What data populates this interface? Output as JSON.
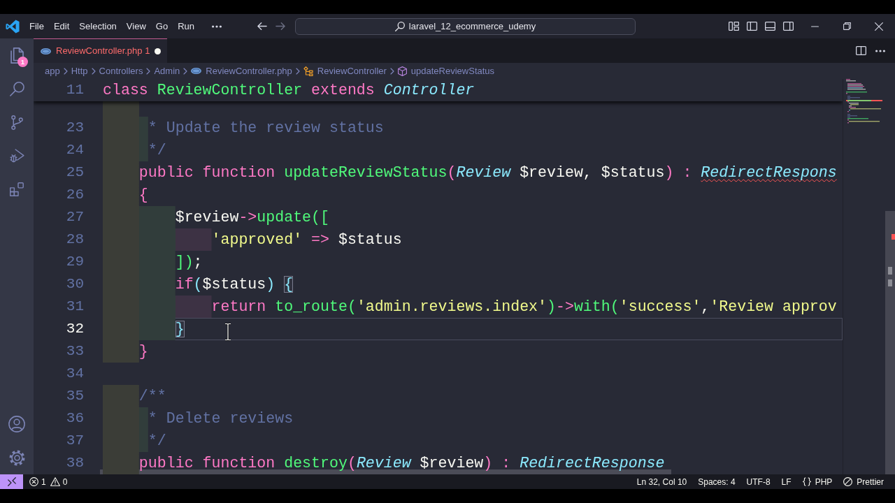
{
  "title_bar": {
    "menus": [
      "File",
      "Edit",
      "Selection",
      "View",
      "Go",
      "Run"
    ],
    "navigation": [
      {
        "kind": "back",
        "disabled": false
      },
      {
        "kind": "forward",
        "disabled": true
      }
    ],
    "search": "laravel_12_ecommerce_udemy"
  },
  "activity_bar": {
    "items": [
      {
        "kind": "explorer",
        "badge": "1",
        "selected": false
      },
      {
        "kind": "search",
        "selected": false
      },
      {
        "kind": "source-control",
        "selected": false
      },
      {
        "kind": "run-debug",
        "selected": false
      },
      {
        "kind": "extensions",
        "selected": false
      }
    ],
    "bottom_items": [
      {
        "kind": "accounts"
      },
      {
        "kind": "manage"
      }
    ]
  },
  "tabs": [
    {
      "label": "ReviewController.php",
      "problems": "1",
      "error": true,
      "dirty": true,
      "selected": true
    }
  ],
  "breadcrumb": [
    {
      "kind": "folder",
      "label": "app"
    },
    {
      "kind": "folder",
      "label": "Http"
    },
    {
      "kind": "folder",
      "label": "Controllers"
    },
    {
      "kind": "folder",
      "label": "Admin"
    },
    {
      "kind": "file",
      "label": "ReviewController.php"
    },
    {
      "kind": "class",
      "label": "ReviewController"
    },
    {
      "kind": "method",
      "label": "updateReviewStatus"
    }
  ],
  "editor": {
    "sticky_lines": [
      {
        "number": "11",
        "current": false,
        "tokens": [
          {
            "text": "class ",
            "kind": "keyword",
            "error": false,
            "matched": false
          },
          {
            "text": "ReviewController ",
            "kind": "entity",
            "error": false,
            "matched": false
          },
          {
            "text": "extends ",
            "kind": "keyword",
            "error": false,
            "matched": false
          },
          {
            "text": "Controller",
            "kind": "type",
            "error": false,
            "matched": false
          }
        ]
      }
    ],
    "lines": [
      {
        "number": "23",
        "current": false,
        "tokens": [
          {
            "text": "     * Update the review status",
            "kind": "comment",
            "error": false,
            "matched": false
          }
        ]
      },
      {
        "number": "24",
        "current": false,
        "tokens": [
          {
            "text": "     */",
            "kind": "comment",
            "error": false,
            "matched": false
          }
        ]
      },
      {
        "number": "25",
        "current": false,
        "tokens": [
          {
            "text": "    public function ",
            "kind": "keyword",
            "error": false,
            "matched": false
          },
          {
            "text": "updateReviewStatus",
            "kind": "entity",
            "error": false,
            "matched": false
          },
          {
            "text": "(",
            "kind": "bracket",
            "color": "#ff79c6",
            "error": false,
            "matched": false
          },
          {
            "text": "Review",
            "kind": "type",
            "error": false,
            "matched": false
          },
          {
            "text": " $review",
            "kind": "variable",
            "error": false,
            "matched": false
          },
          {
            "text": ", ",
            "kind": "plain",
            "error": false,
            "matched": false
          },
          {
            "text": "$status",
            "kind": "variable",
            "error": false,
            "matched": false
          },
          {
            "text": ")",
            "kind": "bracket",
            "color": "#ff79c6",
            "error": false,
            "matched": false
          },
          {
            "text": " : ",
            "kind": "operator",
            "error": false,
            "matched": false
          },
          {
            "text": "RedirectRespons",
            "kind": "type",
            "error": true,
            "matched": false
          }
        ]
      },
      {
        "number": "26",
        "current": false,
        "tokens": [
          {
            "text": "    {",
            "kind": "bracket",
            "color": "#ff79c6",
            "error": false,
            "matched": false
          }
        ]
      },
      {
        "number": "27",
        "current": false,
        "tokens": [
          {
            "text": "        $review",
            "kind": "variable",
            "error": false,
            "matched": false
          },
          {
            "text": "->",
            "kind": "operator",
            "error": false,
            "matched": false
          },
          {
            "text": "update",
            "kind": "entity",
            "error": false,
            "matched": false
          },
          {
            "text": "(",
            "kind": "bracket",
            "color": "#50fa7b",
            "error": false,
            "matched": false
          },
          {
            "text": "[",
            "kind": "bracket",
            "color": "#50fa7b",
            "error": false,
            "matched": false
          }
        ]
      },
      {
        "number": "28",
        "current": false,
        "tokens": [
          {
            "text": "            'approved'",
            "kind": "string",
            "error": false,
            "matched": false
          },
          {
            "text": " => ",
            "kind": "operator",
            "error": false,
            "matched": false
          },
          {
            "text": "$status",
            "kind": "variable",
            "error": false,
            "matched": false
          }
        ]
      },
      {
        "number": "29",
        "current": false,
        "tokens": [
          {
            "text": "        ]",
            "kind": "bracket",
            "color": "#50fa7b",
            "error": false,
            "matched": false
          },
          {
            "text": ")",
            "kind": "bracket",
            "color": "#50fa7b",
            "error": false,
            "matched": false
          },
          {
            "text": ";",
            "kind": "plain",
            "error": false,
            "matched": false
          }
        ]
      },
      {
        "number": "30",
        "current": false,
        "tokens": [
          {
            "text": "        if",
            "kind": "keyword",
            "error": false,
            "matched": false
          },
          {
            "text": "(",
            "kind": "bracket",
            "color": "#8be9fd",
            "error": false,
            "matched": false
          },
          {
            "text": "$status",
            "kind": "variable",
            "error": false,
            "matched": false
          },
          {
            "text": ") ",
            "kind": "bracket",
            "color": "#8be9fd",
            "error": false,
            "matched": false
          },
          {
            "text": "{",
            "kind": "bracket",
            "color": "#8be9fd",
            "error": false,
            "matched": true
          }
        ]
      },
      {
        "number": "31",
        "current": false,
        "tokens": [
          {
            "text": "            return ",
            "kind": "keyword",
            "error": false,
            "matched": false
          },
          {
            "text": "to_route",
            "kind": "entity",
            "error": false,
            "matched": false
          },
          {
            "text": "(",
            "kind": "bracket",
            "color": "#50fa7b",
            "error": false,
            "matched": false
          },
          {
            "text": "'admin.reviews.index'",
            "kind": "string",
            "error": false,
            "matched": false
          },
          {
            "text": ")",
            "kind": "bracket",
            "color": "#50fa7b",
            "error": false,
            "matched": false
          },
          {
            "text": "->",
            "kind": "operator",
            "error": false,
            "matched": false
          },
          {
            "text": "with",
            "kind": "entity",
            "error": false,
            "matched": false
          },
          {
            "text": "(",
            "kind": "bracket",
            "color": "#50fa7b",
            "error": false,
            "matched": false
          },
          {
            "text": "'success'",
            "kind": "string",
            "error": false,
            "matched": false
          },
          {
            "text": ",",
            "kind": "plain",
            "error": false,
            "matched": false
          },
          {
            "text": "'Review approv",
            "kind": "string",
            "error": false,
            "matched": false
          }
        ]
      },
      {
        "number": "32",
        "current": true,
        "tokens": [
          {
            "text": "        }",
            "kind": "bracket",
            "color": "#8be9fd",
            "error": false,
            "matched": true
          }
        ]
      },
      {
        "number": "33",
        "current": false,
        "tokens": [
          {
            "text": "    }",
            "kind": "bracket",
            "color": "#ff79c6",
            "error": false,
            "matched": false
          }
        ]
      },
      {
        "number": "34",
        "current": false
      },
      {
        "number": "35",
        "current": false,
        "tokens": [
          {
            "text": "    /**",
            "kind": "comment",
            "error": false,
            "matched": false
          }
        ]
      },
      {
        "number": "36",
        "current": false,
        "tokens": [
          {
            "text": "     * Delete reviews",
            "kind": "comment",
            "error": false,
            "matched": false
          }
        ]
      },
      {
        "number": "37",
        "current": false,
        "tokens": [
          {
            "text": "     */",
            "kind": "comment",
            "error": false,
            "matched": false
          }
        ]
      },
      {
        "number": "38",
        "current": false,
        "tokens": [
          {
            "text": "    public function ",
            "kind": "keyword",
            "error": false,
            "matched": false
          },
          {
            "text": "destroy",
            "kind": "entity",
            "error": false,
            "matched": false
          },
          {
            "text": "(",
            "kind": "bracket",
            "color": "#ff79c6",
            "error": false,
            "matched": false
          },
          {
            "text": "Review",
            "kind": "type",
            "error": false,
            "matched": false
          },
          {
            "text": " $review",
            "kind": "variable",
            "error": false,
            "matched": false
          },
          {
            "text": ")",
            "kind": "bracket",
            "color": "#ff79c6",
            "error": false,
            "matched": false
          },
          {
            "text": " : ",
            "kind": "operator",
            "error": false,
            "matched": false
          },
          {
            "text": "RedirectResponse",
            "kind": "type",
            "error": false,
            "matched": false
          }
        ]
      }
    ]
  },
  "status_bar": {
    "errors": "1",
    "warnings": "0",
    "items": [
      {
        "kind": "text",
        "label": "Ln 32, Col 10"
      },
      {
        "kind": "text",
        "label": "Spaces: 4"
      },
      {
        "kind": "text",
        "label": "UTF-8"
      },
      {
        "kind": "text",
        "label": "LF"
      },
      {
        "kind": "language",
        "label": "PHP"
      },
      {
        "kind": "formatter",
        "label": "Prettier"
      }
    ]
  }
}
